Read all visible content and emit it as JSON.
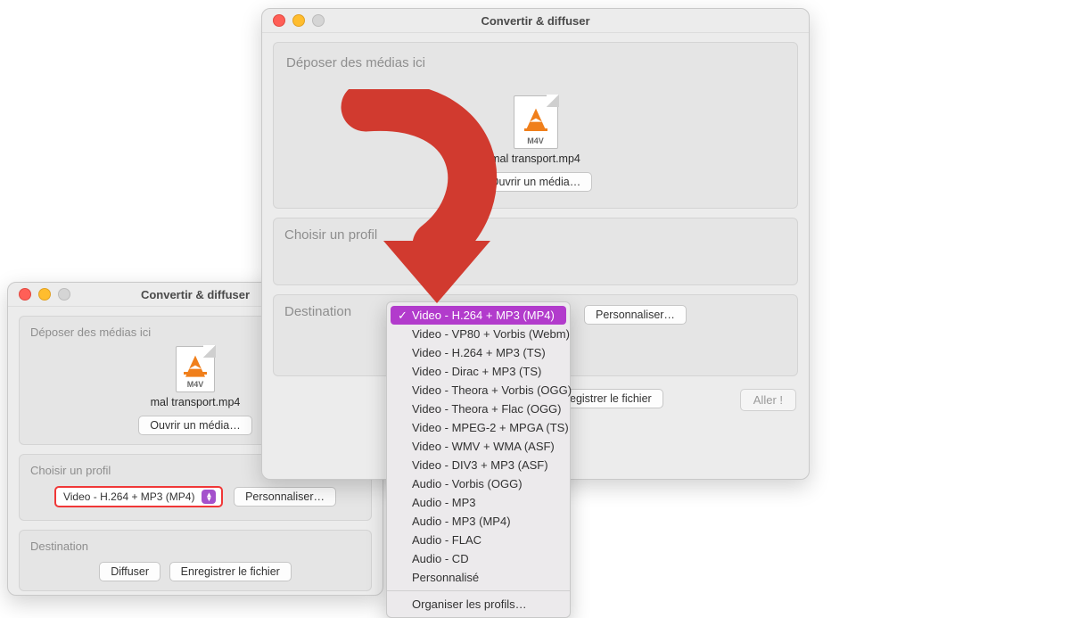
{
  "window_title": "Convertir & diffuser",
  "drop": {
    "title": "Déposer des médias ici",
    "ext": "M4V",
    "filename": "mal transport.mp4",
    "open_btn": "Ouvrir un média…"
  },
  "profile": {
    "title": "Choisir un profil",
    "selected": "Video - H.264 + MP3 (MP4)",
    "customize_btn": "Personnaliser…"
  },
  "destination": {
    "title": "Destination",
    "stream_btn": "Diffuser",
    "save_btn": "Enregistrer le fichier",
    "save_btn_truncated": "egistrer le fichier"
  },
  "go_btn": "Aller !",
  "menu": {
    "items": [
      "Video - H.264 + MP3 (MP4)",
      "Video - VP80 + Vorbis (Webm)",
      "Video - H.264 + MP3 (TS)",
      "Video - Dirac + MP3 (TS)",
      "Video - Theora + Vorbis (OGG)",
      "Video - Theora + Flac (OGG)",
      "Video - MPEG-2 + MPGA (TS)",
      "Video - WMV + WMA (ASF)",
      "Video - DIV3 + MP3 (ASF)",
      "Audio - Vorbis (OGG)",
      "Audio - MP3",
      "Audio - MP3 (MP4)",
      "Audio - FLAC",
      "Audio - CD",
      "Personnalisé"
    ],
    "organize": "Organiser les profils…"
  }
}
